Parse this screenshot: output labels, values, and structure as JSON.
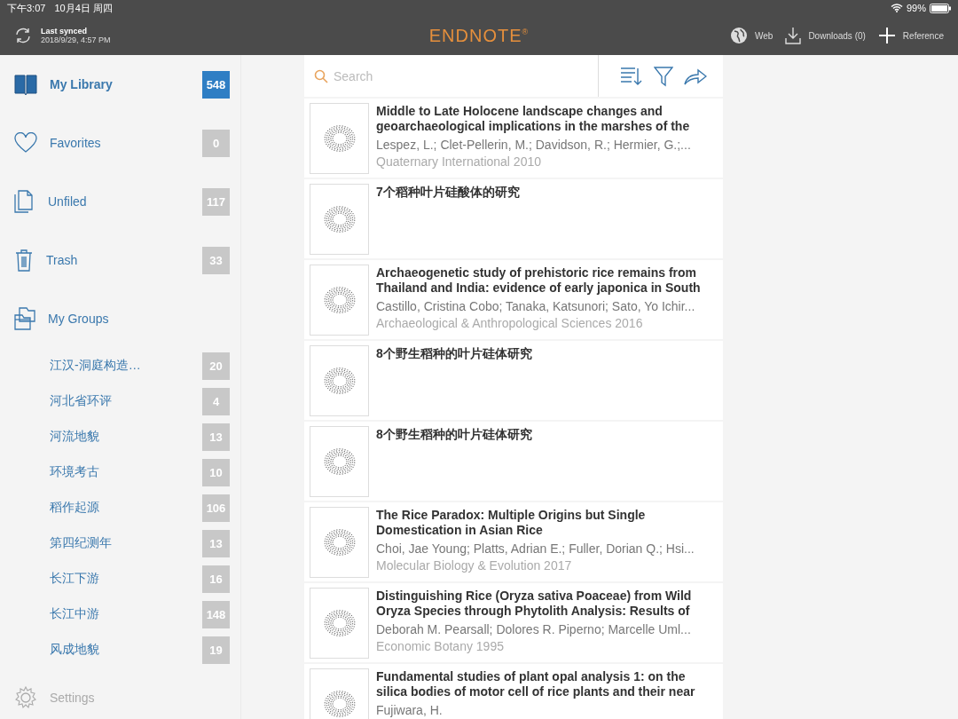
{
  "status_bar": {
    "time": "下午3:07",
    "date": "10月4日 周四",
    "battery": "99%"
  },
  "header": {
    "sync_label": "Last synced",
    "sync_time": "2018/9/29, 4:57 PM",
    "logo": "ENDNOTE$^{®}$",
    "actions": [
      {
        "kind": "web",
        "label": "Web"
      },
      {
        "kind": "downloads",
        "label": "Downloads (0)"
      },
      {
        "kind": "add",
        "label": "Reference"
      }
    ]
  },
  "sidebar": {
    "items": [
      {
        "kind": "library",
        "label": "My Library",
        "count": "548",
        "selected": true
      },
      {
        "kind": "favorites",
        "label": "Favorites",
        "count": "0",
        "selected": false
      },
      {
        "kind": "unfiled",
        "label": "Unfiled",
        "count": "117",
        "selected": false
      },
      {
        "kind": "trash",
        "label": "Trash",
        "count": "33",
        "selected": false
      },
      {
        "kind": "groups",
        "label": "My Groups",
        "selected": false,
        "children": [
          {
            "label": "江汉-洞庭构造…",
            "count": "20",
            "selected": false
          },
          {
            "label": "河北省环评",
            "count": "4",
            "selected": false
          },
          {
            "label": "河流地貌",
            "count": "13",
            "selected": false
          },
          {
            "label": "环境考古",
            "count": "10",
            "selected": false
          },
          {
            "label": "稻作起源",
            "count": "106",
            "selected": false
          },
          {
            "label": "第四纪测年",
            "count": "13",
            "selected": false
          },
          {
            "label": "长江下游",
            "count": "16",
            "selected": false
          },
          {
            "label": "长江中游",
            "count": "148",
            "selected": false
          },
          {
            "label": "风成地貌",
            "count": "19",
            "selected": false
          }
        ]
      }
    ],
    "settings": "Settings"
  },
  "search": {
    "placeholder": "Search"
  },
  "references": [
    {
      "title": "Middle to Late Holocene landscape changes and geoarchaeological implications in the marshes of the",
      "authors": "Lespez, L.; Clet-Pellerin, M.; Davidson, R.; Hermier, G.;...",
      "source": "Quaternary International 2010"
    },
    {
      "title": "7个稻种叶片硅酸体的研究"
    },
    {
      "title": "Archaeogenetic study of prehistoric rice remains from Thailand and India: evidence of early japonica in South",
      "authors": "Castillo, Cristina Cobo; Tanaka, Katsunori; Sato, Yo Ichir...",
      "source": "Archaeological & Anthropological Sciences 2016"
    },
    {
      "title": "8个野生稻种的叶片硅体研究"
    },
    {
      "title": "8个野生稻种的叶片硅体研究"
    },
    {
      "title": "The Rice Paradox: Multiple Origins but Single Domestication in Asian Rice",
      "authors": "Choi, Jae Young; Platts, Adrian E.; Fuller, Dorian Q.; Hsi...",
      "source": "Molecular Biology & Evolution 2017"
    },
    {
      "title": "Distinguishing Rice (Oryza sativa Poaceae) from Wild Oryza Species through Phytolith Analysis: Results of",
      "authors": "Deborah M. Pearsall; Dolores R. Piperno; Marcelle Uml...",
      "source": "Economic Botany 1995"
    },
    {
      "title": "Fundamental studies of plant opal analysis 1: on the silica bodies of motor cell of rice plants and their near",
      "authors": "Fujiwara, H."
    }
  ]
}
